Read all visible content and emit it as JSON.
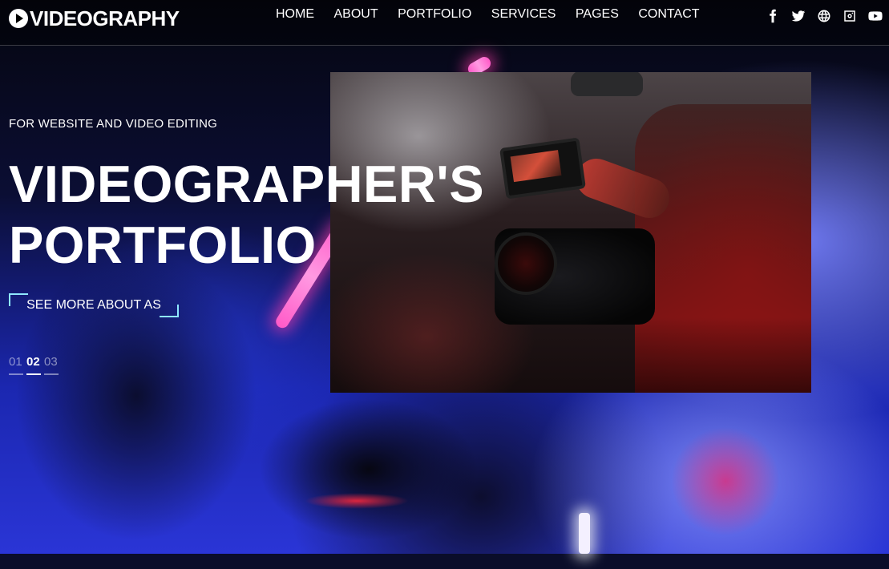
{
  "brand": {
    "logo_text": "VIDEOGRAPHY"
  },
  "nav": {
    "items": [
      {
        "label": "HOME",
        "name": "nav-home"
      },
      {
        "label": "ABOUT",
        "name": "nav-about"
      },
      {
        "label": "PORTFOLIO",
        "name": "nav-portfolio"
      },
      {
        "label": "SERVICES",
        "name": "nav-services"
      },
      {
        "label": "PAGES",
        "name": "nav-pages"
      },
      {
        "label": "CONTACT",
        "name": "nav-contact"
      }
    ]
  },
  "social": {
    "icons": [
      "facebook-icon",
      "twitter-icon",
      "globe-icon",
      "instagram-icon",
      "youtube-icon"
    ]
  },
  "hero": {
    "eyebrow": "FOR WEBSITE AND VIDEO EDITING",
    "headline_line1": "VIDEOGRAPHER'S",
    "headline_line2": "PORTFOLIO",
    "cta_label": "SEE MORE ABOUT AS",
    "cta_accent_color": "#8fe8ff"
  },
  "slider": {
    "pages": [
      "01",
      "02",
      "03"
    ],
    "active_index": 1
  },
  "colors": {
    "neon_pink": "#ff5ac8",
    "background_blue": "#2a35d6"
  }
}
